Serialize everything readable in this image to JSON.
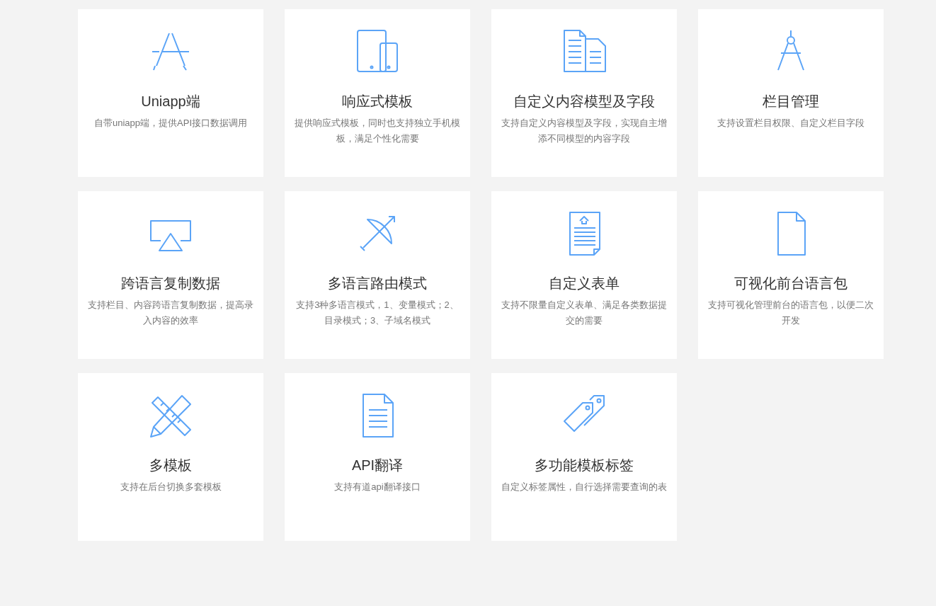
{
  "features": [
    {
      "title": "Uniapp端",
      "description": "自带uniapp端，提供API接口数据调用"
    },
    {
      "title": "响应式模板",
      "description": "提供响应式模板，同时也支持独立手机模板，满足个性化需要"
    },
    {
      "title": "自定义内容模型及字段",
      "description": "支持自定义内容模型及字段，实现自主增添不同模型的内容字段"
    },
    {
      "title": "栏目管理",
      "description": "支持设置栏目权限、自定义栏目字段"
    },
    {
      "title": "跨语言复制数据",
      "description": "支持栏目、内容跨语言复制数据，提高录入内容的效率"
    },
    {
      "title": "多语言路由模式",
      "description": "支持3种多语言模式，1、变量模式；2、目录模式；3、子域名模式"
    },
    {
      "title": "自定义表单",
      "description": "支持不限量自定义表单、满足各类数据提交的需要"
    },
    {
      "title": "可视化前台语言包",
      "description": "支持可视化管理前台的语言包，以便二次开发"
    },
    {
      "title": "多模板",
      "description": "支持在后台切换多套模板"
    },
    {
      "title": "API翻译",
      "description": "支持有道api翻译接口"
    },
    {
      "title": "多功能模板标签",
      "description": "自定义标签属性，自行选择需要查询的表"
    }
  ]
}
